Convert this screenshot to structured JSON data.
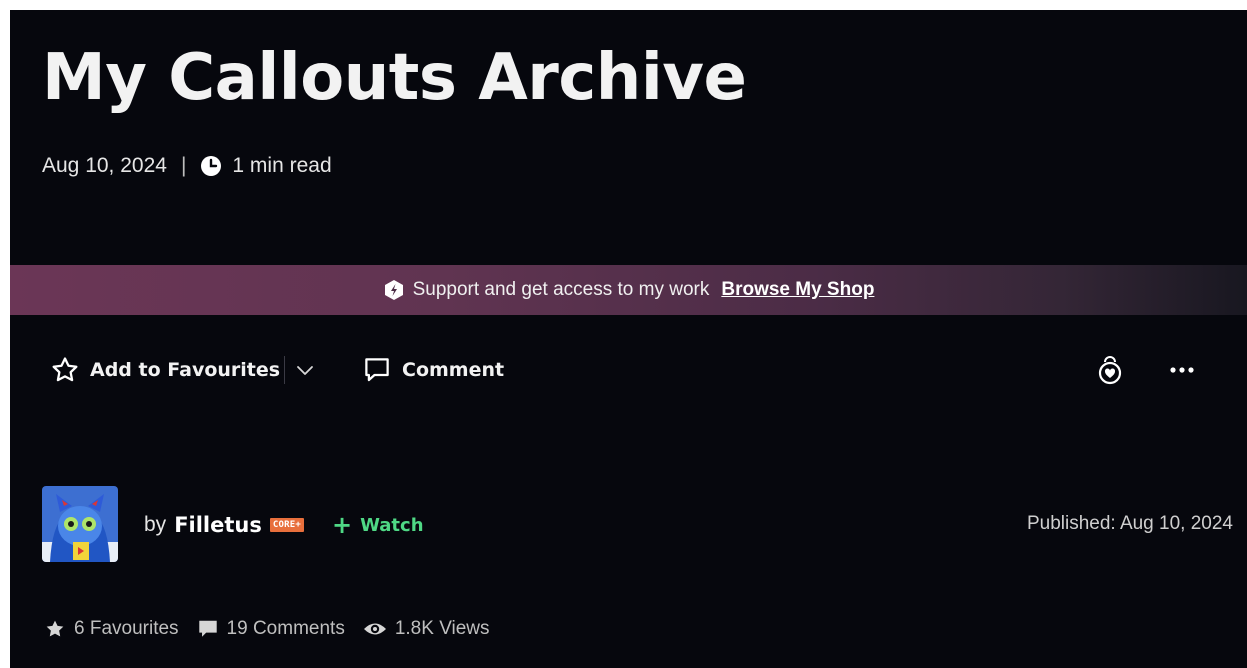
{
  "deviation": {
    "title": "My Callouts Archive",
    "date": "Aug 10, 2024",
    "separator": "|",
    "read_time": "1 min read"
  },
  "banner": {
    "text": "Support and get access to my work",
    "link": "Browse My Shop"
  },
  "actions": {
    "favourite_label": "Add to Favourites",
    "comment_label": "Comment"
  },
  "author": {
    "by": "by",
    "name": "Filletus",
    "badge": "CORE+",
    "watch_plus": "+",
    "watch_label": "Watch",
    "published": "Published: Aug 10, 2024"
  },
  "stats": {
    "favourites": "6 Favourites",
    "comments": "19 Comments",
    "views": "1.8K Views"
  },
  "colors": {
    "background": "#06070d",
    "watch": "#4fd885",
    "badge": "#e86f3c",
    "banner_start": "#6b3656"
  },
  "icons": [
    "clock-icon",
    "shop-icon",
    "star-outline-icon",
    "chevron-down-icon",
    "comment-icon",
    "give-icon",
    "more-icon",
    "star-icon",
    "comment-filled-icon",
    "eye-icon"
  ]
}
